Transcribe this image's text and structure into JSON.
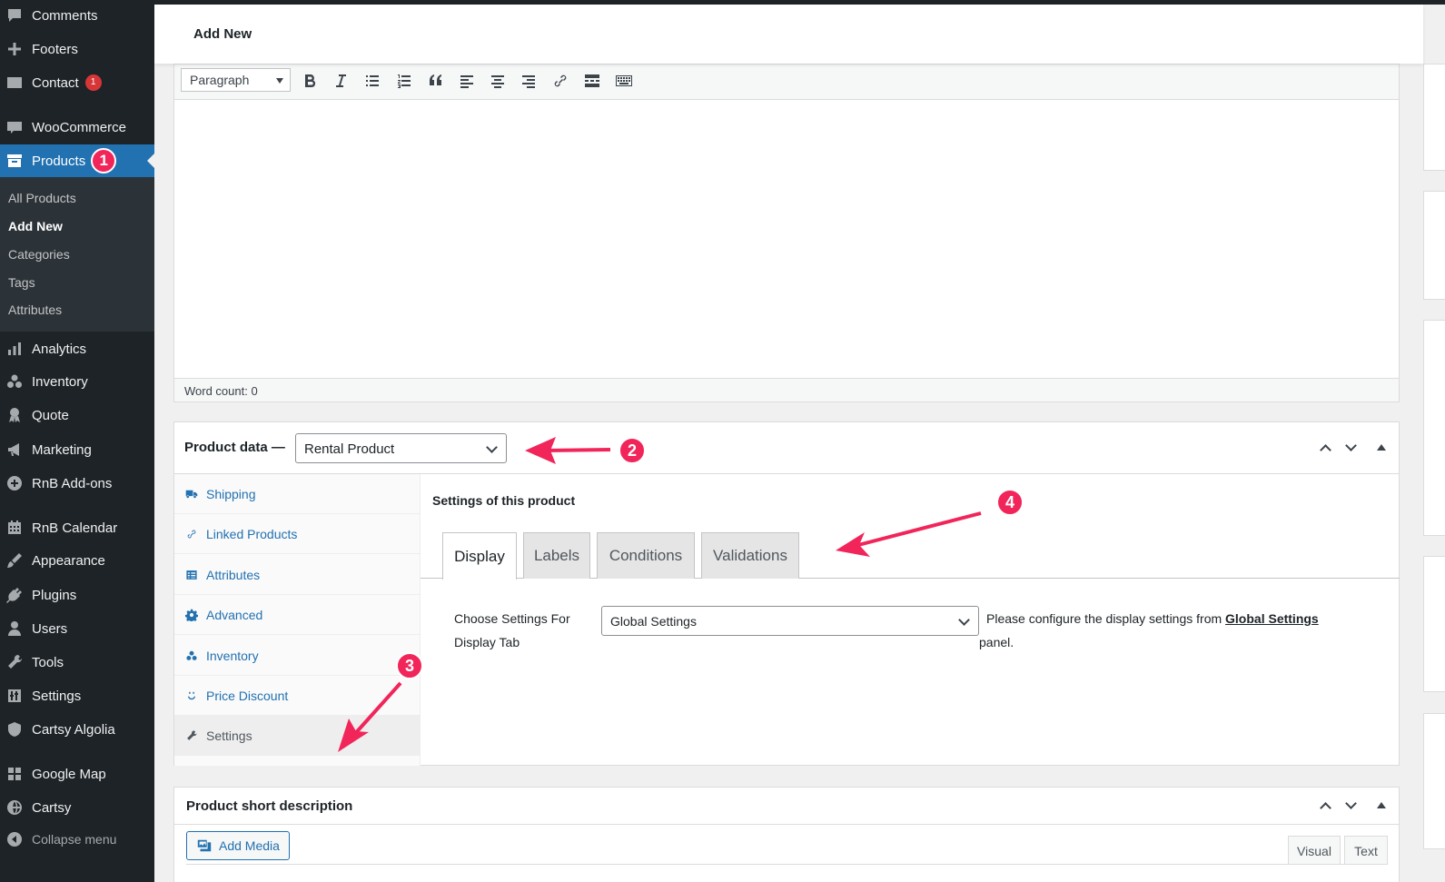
{
  "sidebar": {
    "items": [
      {
        "label": "Comments",
        "icon": "comment-icon"
      },
      {
        "label": "Footers",
        "icon": "plus-icon"
      },
      {
        "label": "Contact",
        "icon": "mail-icon",
        "badge": "1"
      },
      {
        "label": "WooCommerce",
        "icon": "woocommerce-icon"
      },
      {
        "label": "Products",
        "icon": "archive-icon",
        "badge": "1"
      },
      {
        "label": "Analytics",
        "icon": "bar-chart-icon"
      },
      {
        "label": "Inventory",
        "icon": "inventory-icon"
      },
      {
        "label": "Quote",
        "icon": "award-icon"
      },
      {
        "label": "Marketing",
        "icon": "megaphone-icon"
      },
      {
        "label": "RnB Add-ons",
        "icon": "plus-circle-icon"
      },
      {
        "label": "RnB Calendar",
        "icon": "calendar-icon"
      },
      {
        "label": "Appearance",
        "icon": "brush-icon"
      },
      {
        "label": "Plugins",
        "icon": "plug-icon"
      },
      {
        "label": "Users",
        "icon": "user-icon"
      },
      {
        "label": "Tools",
        "icon": "wrench-icon"
      },
      {
        "label": "Settings",
        "icon": "settings-sliders-icon"
      },
      {
        "label": "Cartsy Algolia",
        "icon": "shield-icon"
      },
      {
        "label": "Google Map",
        "icon": "grid-icon"
      },
      {
        "label": "Cartsy",
        "icon": "globe-icon"
      }
    ],
    "submenu": [
      "All Products",
      "Add New",
      "Categories",
      "Tags",
      "Attributes"
    ],
    "collapse_label": "Collapse menu"
  },
  "header": {
    "title": "Add New"
  },
  "editor": {
    "format_value": "Paragraph",
    "word_count": "Word count: 0"
  },
  "product_data": {
    "title": "Product data —",
    "type_value": "Rental Product",
    "tabs": [
      "Shipping",
      "Linked Products",
      "Attributes",
      "Advanced",
      "Inventory",
      "Price Discount",
      "Settings"
    ],
    "panel_heading": "Settings of this product",
    "inner_tabs": [
      "Display",
      "Labels",
      "Conditions",
      "Validations"
    ],
    "field_label": "Choose Settings For Display Tab",
    "field_value": "Global Settings",
    "desc_prefix": "Please configure the display settings from",
    "desc_link": "Global Settings",
    "desc_suffix": "panel."
  },
  "short_description": {
    "title": "Product short description",
    "add_media": "Add Media",
    "mode_visual": "Visual",
    "mode_text": "Text"
  },
  "annotations": [
    "2",
    "3",
    "4"
  ],
  "colors": {
    "accent": "#2271b1",
    "sidebar": "#1d2327",
    "annotation": "#f1255a"
  }
}
